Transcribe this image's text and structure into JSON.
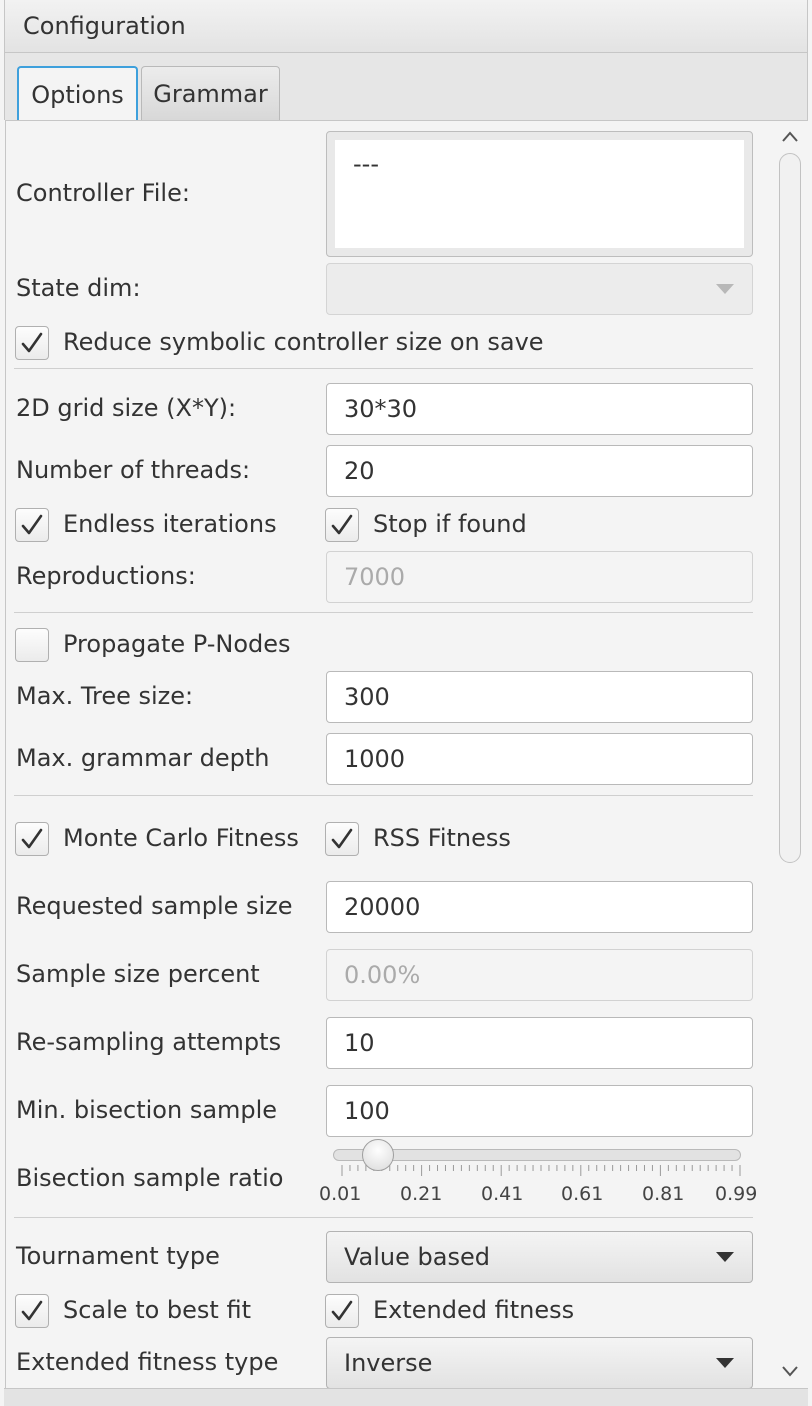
{
  "window": {
    "title": "Configuration"
  },
  "tabs": [
    {
      "label": "Options",
      "active": true
    },
    {
      "label": "Grammar",
      "active": false
    }
  ],
  "options": {
    "controller_file": {
      "label": "Controller File:",
      "value": "---"
    },
    "state_dim": {
      "label": "State dim:",
      "value": ""
    },
    "reduce_symbolic": {
      "label": "Reduce symbolic controller size on save",
      "checked": true
    },
    "grid_size": {
      "label": "2D grid size (X*Y):",
      "value": "30*30"
    },
    "num_threads": {
      "label": "Number of threads:",
      "value": "20"
    },
    "endless_iterations": {
      "label": "Endless iterations",
      "checked": true
    },
    "stop_if_found": {
      "label": "Stop if found",
      "checked": true
    },
    "reproductions": {
      "label": "Reproductions:",
      "value": "7000",
      "disabled": true
    },
    "propagate_pnodes": {
      "label": "Propagate P-Nodes",
      "checked": false
    },
    "max_tree_size": {
      "label": "Max. Tree size:",
      "value": "300"
    },
    "max_grammar_depth": {
      "label": "Max. grammar depth",
      "value": "1000"
    },
    "monte_carlo_fitness": {
      "label": "Monte Carlo Fitness",
      "checked": true
    },
    "rss_fitness": {
      "label": "RSS Fitness",
      "checked": true
    },
    "requested_sample_size": {
      "label": "Requested sample size",
      "value": "20000"
    },
    "sample_size_percent": {
      "label": "Sample size percent",
      "value": "0.00%",
      "disabled": true
    },
    "resampling_attempts": {
      "label": "Re-sampling attempts",
      "value": "10"
    },
    "min_bisection_sample": {
      "label": "Min. bisection sample",
      "value": "100"
    },
    "bisection_sample_ratio": {
      "label": "Bisection sample ratio",
      "value": 0.1,
      "min": 0.01,
      "max": 0.99,
      "tick_labels": [
        "0.01",
        "0.21",
        "0.41",
        "0.61",
        "0.81",
        "0.99"
      ]
    },
    "tournament_type": {
      "label": "Tournament type",
      "value": "Value based"
    },
    "scale_to_best_fit": {
      "label": "Scale to best fit",
      "checked": true
    },
    "extended_fitness": {
      "label": "Extended fitness",
      "checked": true
    },
    "extended_fitness_type": {
      "label": "Extended fitness type",
      "value": "Inverse"
    }
  },
  "colors": {
    "tab_focus": "#3ea0dc",
    "background": "#f4f4f4",
    "disabled_text": "#aaaaaa"
  },
  "icons": {
    "check": "check-icon",
    "dropdown": "chevron-down-icon",
    "scroll_up": "chevron-up-icon",
    "scroll_down": "chevron-down-icon"
  }
}
